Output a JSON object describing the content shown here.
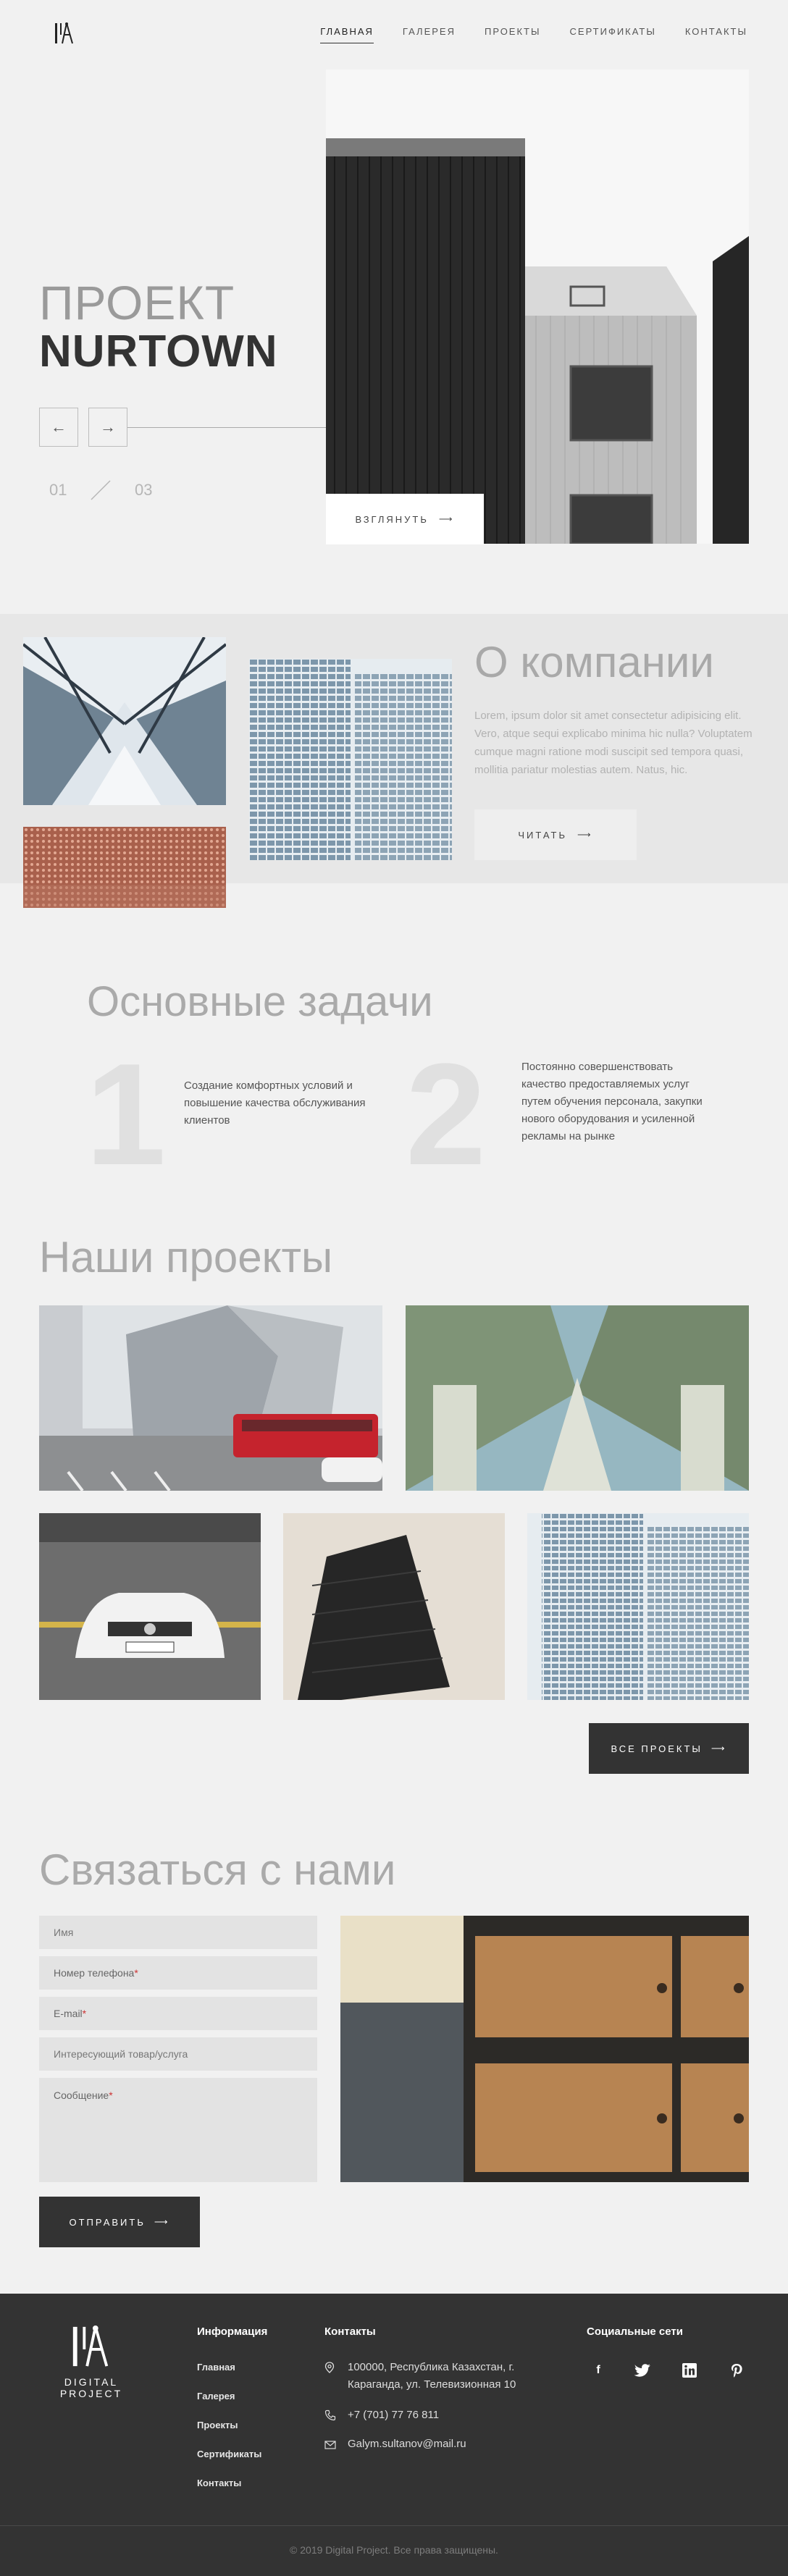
{
  "header": {
    "nav": [
      "Главная",
      "Галерея",
      "Проекты",
      "Сертификаты",
      "Контакты"
    ]
  },
  "hero": {
    "title_light": "ПРОЕКТ",
    "title_bold": "NURTOWN",
    "counter_current": "01",
    "counter_total": "03",
    "look_button": "Взглянуть"
  },
  "about": {
    "title": "О компании",
    "text": "Lorem, ipsum dolor sit amet consectetur adipisicing elit. Vero, atque sequi explicabo minima hic nulla? Voluptatem cumque magni ratione modi suscipit sed tempora quasi, mollitia pariatur molestias autem. Natus, hic.",
    "read_button": "Читать"
  },
  "tasks": {
    "title": "Основные задачи",
    "items": [
      {
        "num": "1",
        "text": "Создание комфортных условий и повышение качества обслуживания клиентов"
      },
      {
        "num": "2",
        "text": "Постоянно совершенствовать качество предоставляемых услуг путем обучения персонала, закупки нового оборудования и усиленной рекламы на рынке"
      }
    ]
  },
  "projects": {
    "title": "Наши проекты",
    "all_button": "Все проекты"
  },
  "contact": {
    "title": "Связаться с нами",
    "fields": {
      "name": "Имя",
      "phone": "Номер телефона",
      "email": "E-mail",
      "product": "Интересующий товар/услуга",
      "message": "Сообщение"
    },
    "required_mark": "*",
    "send_button": "Отправить"
  },
  "footer": {
    "brand": "DIGITAL PROJECT",
    "info_title": "Информация",
    "info_links": [
      "Главная",
      "Галерея",
      "Проекты",
      "Сертификаты",
      "Контакты"
    ],
    "contacts_title": "Контакты",
    "address": "100000, Республика Казахстан, г. Караганда, ул. Телевизионная 10",
    "phone": "+7 (701) 77 76 811",
    "email": "Galym.sultanov@mail.ru",
    "social_title": "Социальные сети",
    "social_icons": [
      "facebook-icon",
      "twitter-icon",
      "linkedin-icon",
      "pinterest-icon"
    ],
    "copyright": "© 2019 Digital Project. Все права защищены."
  },
  "colors": {
    "background": "#f1f1f1",
    "dark": "#333333",
    "muted_title": "#aaaaaa"
  }
}
